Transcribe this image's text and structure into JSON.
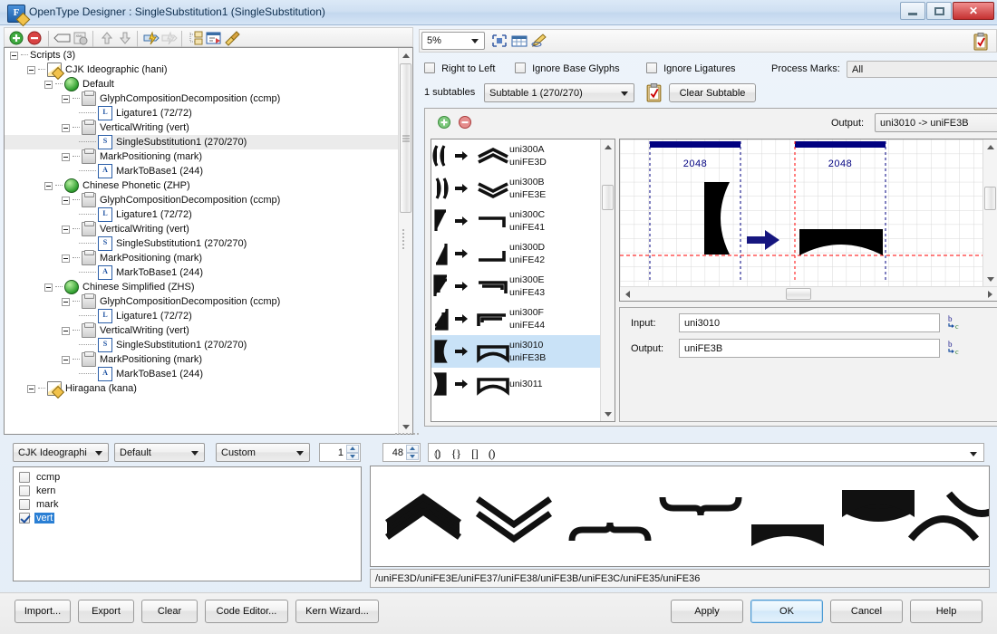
{
  "window": {
    "title": "OpenType Designer : SingleSubstitution1 (SingleSubstitution)",
    "app_icon": "opentype-designer-icon",
    "minimize_label": "",
    "maximize_label": "",
    "close_label": "✕"
  },
  "left_toolbar": {
    "buttons": [
      {
        "name": "add-icon",
        "glyph": "+"
      },
      {
        "name": "remove-icon",
        "glyph": "−"
      },
      {
        "name": "rename-tag-icon",
        "glyph": ""
      },
      {
        "name": "xml-properties-icon",
        "glyph": ""
      },
      {
        "name": "move-up-icon",
        "glyph": "⇧"
      },
      {
        "name": "move-down-icon",
        "glyph": "⇩"
      },
      {
        "name": "compile-icon",
        "glyph": ""
      },
      {
        "name": "compile-all-icon",
        "glyph": ""
      },
      {
        "name": "copy-structure-icon",
        "glyph": ""
      },
      {
        "name": "edit-features-icon",
        "glyph": ""
      },
      {
        "name": "clean-icon",
        "glyph": ""
      }
    ]
  },
  "tree": {
    "root_label": "Scripts (3)",
    "nodes": [
      {
        "depth": 0,
        "icon": "expander",
        "label": "Scripts (3)",
        "kind": "root",
        "selected": false
      },
      {
        "depth": 1,
        "icon": "script-icon",
        "label": "CJK Ideographic (hani)",
        "kind": "script",
        "selected": false
      },
      {
        "depth": 2,
        "icon": "language-icon",
        "label": "Default",
        "kind": "lang",
        "selected": false
      },
      {
        "depth": 3,
        "icon": "feature-icon",
        "label": "GlyphCompositionDecomposition (ccmp)",
        "kind": "feature",
        "selected": false
      },
      {
        "depth": 4,
        "icon": "lookup-ligature-icon",
        "label": "Ligature1 (72/72)",
        "kind": "lookup",
        "badge": "L",
        "selected": false
      },
      {
        "depth": 3,
        "icon": "feature-icon",
        "label": "VerticalWriting (vert)",
        "kind": "feature",
        "selected": false
      },
      {
        "depth": 4,
        "icon": "lookup-single-sub-icon",
        "label": "SingleSubstitution1 (270/270)",
        "kind": "lookup",
        "badge": "S",
        "selected": true
      },
      {
        "depth": 3,
        "icon": "feature-icon",
        "label": "MarkPositioning (mark)",
        "kind": "feature",
        "selected": false
      },
      {
        "depth": 4,
        "icon": "lookup-mark-icon",
        "label": "MarkToBase1 (244)",
        "kind": "lookup",
        "badge": "A",
        "selected": false
      },
      {
        "depth": 2,
        "icon": "language-icon",
        "label": "Chinese Phonetic (ZHP)",
        "kind": "lang",
        "selected": false
      },
      {
        "depth": 3,
        "icon": "feature-icon",
        "label": "GlyphCompositionDecomposition (ccmp)",
        "kind": "feature",
        "selected": false
      },
      {
        "depth": 4,
        "icon": "lookup-ligature-icon",
        "label": "Ligature1 (72/72)",
        "kind": "lookup",
        "badge": "L",
        "selected": false
      },
      {
        "depth": 3,
        "icon": "feature-icon",
        "label": "VerticalWriting (vert)",
        "kind": "feature",
        "selected": false
      },
      {
        "depth": 4,
        "icon": "lookup-single-sub-icon",
        "label": "SingleSubstitution1 (270/270)",
        "kind": "lookup",
        "badge": "S",
        "selected": false
      },
      {
        "depth": 3,
        "icon": "feature-icon",
        "label": "MarkPositioning (mark)",
        "kind": "feature",
        "selected": false
      },
      {
        "depth": 4,
        "icon": "lookup-mark-icon",
        "label": "MarkToBase1 (244)",
        "kind": "lookup",
        "badge": "A",
        "selected": false
      },
      {
        "depth": 2,
        "icon": "language-icon",
        "label": "Chinese Simplified (ZHS)",
        "kind": "lang",
        "selected": false
      },
      {
        "depth": 3,
        "icon": "feature-icon",
        "label": "GlyphCompositionDecomposition (ccmp)",
        "kind": "feature",
        "selected": false
      },
      {
        "depth": 4,
        "icon": "lookup-ligature-icon",
        "label": "Ligature1 (72/72)",
        "kind": "lookup",
        "badge": "L",
        "selected": false
      },
      {
        "depth": 3,
        "icon": "feature-icon",
        "label": "VerticalWriting (vert)",
        "kind": "feature",
        "selected": false
      },
      {
        "depth": 4,
        "icon": "lookup-single-sub-icon",
        "label": "SingleSubstitution1 (270/270)",
        "kind": "lookup",
        "badge": "S",
        "selected": false
      },
      {
        "depth": 3,
        "icon": "feature-icon",
        "label": "MarkPositioning (mark)",
        "kind": "feature",
        "selected": false
      },
      {
        "depth": 4,
        "icon": "lookup-mark-icon",
        "label": "MarkToBase1 (244)",
        "kind": "lookup",
        "badge": "A",
        "selected": false
      },
      {
        "depth": 1,
        "icon": "script-icon",
        "label": "Hiragana (kana)",
        "kind": "script",
        "selected": false
      }
    ]
  },
  "right_toolbar": {
    "zoom_value": "5%",
    "icons": [
      {
        "name": "fit-view-icon"
      },
      {
        "name": "grid-table-icon"
      },
      {
        "name": "pencil-edit-icon"
      }
    ],
    "clipboard_icon": "clipboard-check-icon"
  },
  "lookup_flags": {
    "right_to_left": {
      "label": "Right to Left",
      "checked": false
    },
    "ignore_base_glyphs": {
      "label": "Ignore Base Glyphs",
      "checked": false
    },
    "ignore_ligatures": {
      "label": "Ignore Ligatures",
      "checked": false
    },
    "process_marks_label": "Process Marks:",
    "process_marks_value": "All"
  },
  "subtables": {
    "count_label": "1 subtables",
    "selected": "Subtable 1 (270/270)",
    "clipboard_icon": "clipboard-check-icon",
    "clear_button": "Clear Subtable"
  },
  "subtable_panel": {
    "add_icon": "add-row-icon",
    "remove_icon": "remove-row-icon",
    "output_label": "Output:",
    "output_value": "uni3010 -> uniFE3B"
  },
  "glyph_list": {
    "rows": [
      {
        "input": "uni300A",
        "output": "uniFE3D",
        "selected": false
      },
      {
        "input": "uni300B",
        "output": "uniFE3E",
        "selected": false
      },
      {
        "input": "uni300C",
        "output": "uniFE41",
        "selected": false
      },
      {
        "input": "uni300D",
        "output": "uniFE42",
        "selected": false
      },
      {
        "input": "uni300E",
        "output": "uniFE43",
        "selected": false
      },
      {
        "input": "uni300F",
        "output": "uniFE44",
        "selected": false
      },
      {
        "input": "uni3010",
        "output": "uniFE3B",
        "selected": true
      },
      {
        "input": "uni3011",
        "output": "",
        "selected": false
      }
    ]
  },
  "preview": {
    "advance_width_left": "2048",
    "advance_width_right": "2048",
    "arrow_icon": "right-arrow-icon",
    "grid": true
  },
  "pair_editor": {
    "input_label": "Input:",
    "input_value": "uni3010",
    "output_label": "Output:",
    "output_value": "uniFE3B",
    "picker_icon": "glyph-picker-icon"
  },
  "bottom_bar": {
    "script_combo": "CJK Ideographi",
    "language_combo": "Default",
    "mode_combo": "Custom",
    "index_spin": "1",
    "size_spin": "48",
    "bracket_buttons": [
      {
        "name": "double-paren-icon",
        "glyph": "⦅⦆"
      },
      {
        "name": "brace-icon",
        "glyph": "{}"
      },
      {
        "name": "bracket-icon",
        "glyph": "[]"
      },
      {
        "name": "paren-icon",
        "glyph": "()"
      }
    ],
    "sample_combo_value": ""
  },
  "feature_list": {
    "items": [
      {
        "label": "ccmp",
        "checked": false,
        "selected": false
      },
      {
        "label": "kern",
        "checked": false,
        "selected": false
      },
      {
        "label": "mark",
        "checked": false,
        "selected": false
      },
      {
        "label": "vert",
        "checked": true,
        "selected": true
      }
    ]
  },
  "sample_preview": {
    "status_text": "/uniFE3D/uniFE3E/uniFE37/uniFE38/uniFE3B/uniFE3C/uniFE35/uniFE36",
    "glyph_names": [
      "uniFE3D",
      "uniFE3E",
      "uniFE37",
      "uniFE38",
      "uniFE3B",
      "uniFE3C",
      "uniFE35",
      "uniFE36"
    ]
  },
  "footer": {
    "left_buttons": [
      {
        "name": "import-button",
        "label": "Import..."
      },
      {
        "name": "export-button",
        "label": "Export"
      },
      {
        "name": "clear-button",
        "label": "Clear"
      },
      {
        "name": "code-editor-button",
        "label": "Code Editor..."
      },
      {
        "name": "kern-wizard-button",
        "label": "Kern Wizard..."
      }
    ],
    "right_buttons": [
      {
        "name": "apply-button",
        "label": "Apply",
        "default": false
      },
      {
        "name": "ok-button",
        "label": "OK",
        "default": true
      },
      {
        "name": "cancel-button",
        "label": "Cancel",
        "default": false
      },
      {
        "name": "help-button",
        "label": "Help",
        "default": false
      }
    ]
  },
  "colors": {
    "selection_blue": "#c9e2f7",
    "highlight_blue": "#2a7fd4",
    "metric_navy": "#000080",
    "baseline_red": "#ff0000",
    "arrow_navy": "#1a1a8c"
  }
}
